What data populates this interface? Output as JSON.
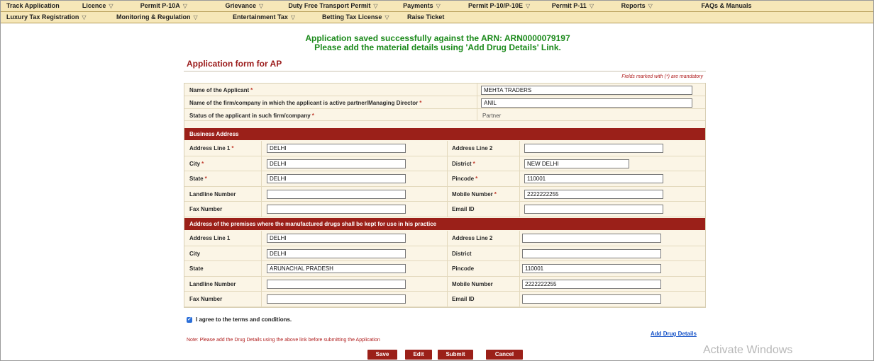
{
  "nav_row1": [
    {
      "label": "Track Application",
      "caret": false
    },
    {
      "label": "Licence",
      "caret": true
    },
    {
      "label": "Permit P-10A",
      "caret": true
    },
    {
      "label": "Grievance",
      "caret": true
    },
    {
      "label": "Duty Free Transport Permit",
      "caret": true
    },
    {
      "label": "Payments",
      "caret": true
    },
    {
      "label": "Permit P-10/P-10E",
      "caret": true
    },
    {
      "label": "Permit P-11",
      "caret": true
    },
    {
      "label": "Reports",
      "caret": true
    },
    {
      "label": "FAQs & Manuals",
      "caret": false
    }
  ],
  "nav_row2": [
    {
      "label": "Luxury Tax Registration",
      "caret": true
    },
    {
      "label": "Monitoring & Regulation",
      "caret": true
    },
    {
      "label": "Entertainment Tax",
      "caret": true
    },
    {
      "label": "Betting Tax License",
      "caret": true
    },
    {
      "label": "Raise Ticket",
      "caret": false
    }
  ],
  "message": {
    "line1": "Application saved successfully against the ARN: ARN0000079197",
    "line2": "Please add the material details using 'Add Drug Details' Link."
  },
  "form": {
    "title": "Application form for AP",
    "mandatory_note": "Fields marked with (*) are mandatory",
    "applicant_name_label": "Name of the Applicant",
    "applicant_name": "MEHTA TRADERS",
    "firm_label": "Name of the firm/company in which the applicant is active partner/Managing Director",
    "firm_value": "ANIL",
    "status_label": "Status of the applicant in such firm/company",
    "status_value": "Partner",
    "required_mark": "*"
  },
  "business_address": {
    "heading": "Business Address",
    "address1_label": "Address Line 1",
    "address1": "DELHI",
    "address2_label": "Address Line 2",
    "address2": "",
    "city_label": "City",
    "city": "DELHI",
    "district_label": "District",
    "district": "NEW DELHI",
    "state_label": "State",
    "state": "DELHI",
    "pincode_label": "Pincode",
    "pincode": "110001",
    "landline_label": "Landline Number",
    "landline": "",
    "mobile_label": "Mobile Number",
    "mobile": "2222222255",
    "fax_label": "Fax Number",
    "fax": "",
    "email_label": "Email ID",
    "email": ""
  },
  "premises_address": {
    "heading": "Address of the premises where the manufactured drugs shall be kept for use in his practice",
    "address1_label": "Address Line 1",
    "address1": "DELHI",
    "address2_label": "Address Line 2",
    "address2": "",
    "city_label": "City",
    "city": "DELHI",
    "district_label": "District",
    "district": "",
    "state_label": "State",
    "state": "ARUNACHAL PRADESH",
    "pincode_label": "Pincode",
    "pincode": "110001",
    "landline_label": "Landline Number",
    "landline": "",
    "mobile_label": "Mobile Number",
    "mobile": "2222222255",
    "fax_label": "Fax Number",
    "fax": "",
    "email_label": "Email ID",
    "email": ""
  },
  "agree_text": "I agree to the terms and conditions.",
  "add_drug_link": "Add Drug Details",
  "note": "Note: Please add the Drug Details using the above link before submitting the Application",
  "buttons": {
    "save": "Save",
    "edit": "Edit",
    "submit": "Submit",
    "cancel": "Cancel"
  },
  "watermark": "Activate Windows",
  "colors": {
    "nav_bg": "#f6e7b8",
    "section_bg": "#9b2019",
    "success": "#1c8a1c",
    "link": "#1a56c9"
  }
}
